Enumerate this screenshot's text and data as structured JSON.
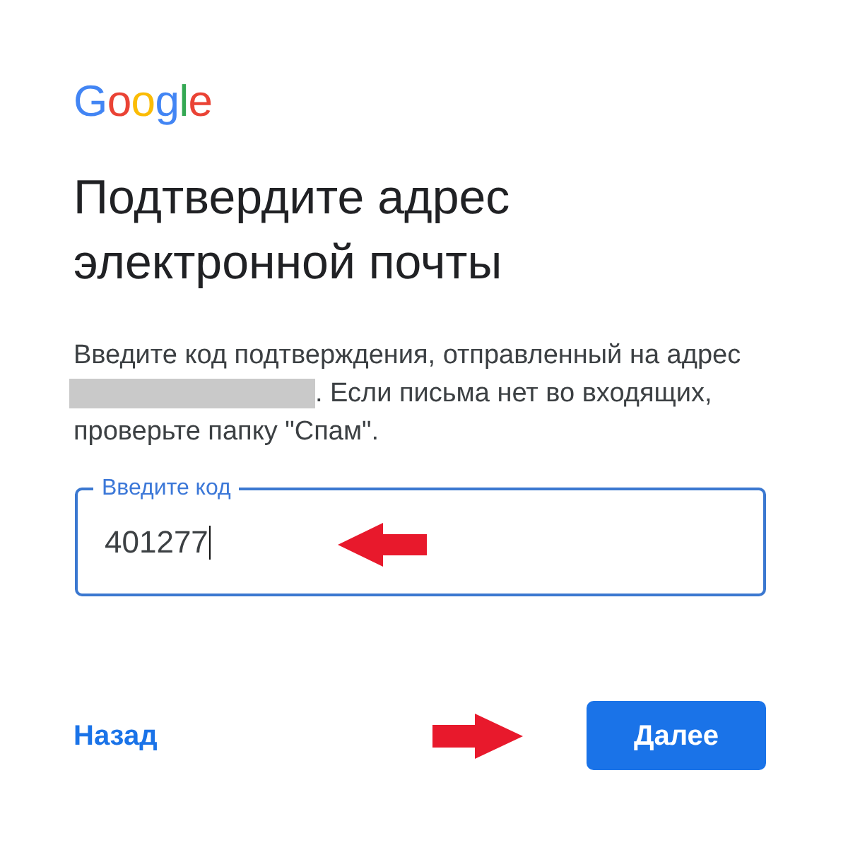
{
  "logo": {
    "text": "Google"
  },
  "heading": "Подтвердите адрес электронной почты",
  "message_lines": [
    {
      "redacted_prefix": false,
      "text": "Введите код подтверждения, отправленный на адрес"
    },
    {
      "redacted_prefix": true,
      "text": ". Если письма нет во входящих,"
    },
    {
      "redacted_prefix": false,
      "text": "проверьте папку \"Спам\"."
    }
  ],
  "code_field": {
    "label": "Введите код",
    "value": "401277",
    "focused": true
  },
  "actions": [
    {
      "kind": "link",
      "label": "Назад"
    },
    {
      "kind": "button",
      "label": "Далее"
    }
  ]
}
